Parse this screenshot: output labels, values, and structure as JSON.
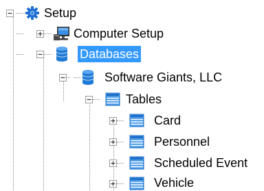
{
  "tree": {
    "root": {
      "label": "Setup",
      "icon": "gear-icon",
      "expanded": true
    },
    "computer_setup": {
      "label": "Computer Setup",
      "icon": "computer-icon",
      "expanded": false
    },
    "databases": {
      "label": "Databases",
      "icon": "database-icon",
      "expanded": true,
      "selected": true
    },
    "company": {
      "label": "Software Giants, LLC",
      "icon": "database-icon",
      "expanded": true
    },
    "tables": {
      "label": "Tables",
      "icon": "table-icon",
      "expanded": true
    },
    "table_items": [
      {
        "label": "Card",
        "icon": "table-icon",
        "expanded": false
      },
      {
        "label": "Personnel",
        "icon": "table-icon",
        "expanded": false
      },
      {
        "label": "Scheduled Event",
        "icon": "table-icon",
        "expanded": false
      },
      {
        "label": "Vehicle",
        "icon": "table-icon",
        "expanded": false
      }
    ]
  },
  "colors": {
    "selection": "#3399ff",
    "database": "#1f7ad6",
    "table": "#4a9be8",
    "gear": "#1d6fd1"
  }
}
